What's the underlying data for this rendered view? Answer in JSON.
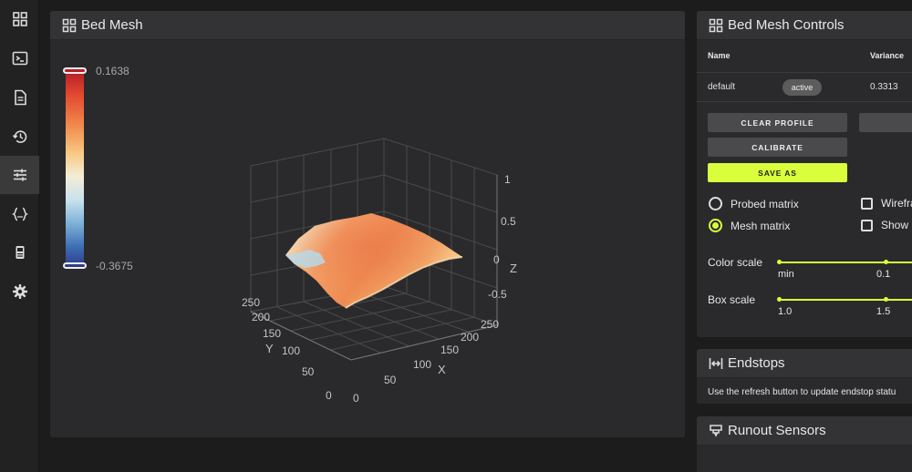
{
  "nav": {
    "items": [
      {
        "icon": "dashboard-icon"
      },
      {
        "icon": "console-icon"
      },
      {
        "icon": "document-icon"
      },
      {
        "icon": "history-icon"
      },
      {
        "icon": "tune-icon",
        "active": true
      },
      {
        "icon": "code-braces-icon"
      },
      {
        "icon": "printer-icon"
      },
      {
        "icon": "gear-icon"
      }
    ]
  },
  "mesh": {
    "title": "Bed Mesh",
    "scale_max": "0.1638",
    "scale_min": "-0.3675",
    "z_ticks": [
      "1",
      "0.5",
      "0",
      "-0.5"
    ],
    "z_label": "Z",
    "y_ticks": [
      "250",
      "200",
      "150",
      "100",
      "50",
      "0"
    ],
    "y_label": "Y",
    "x_ticks": [
      "0",
      "50",
      "100",
      "150",
      "200",
      "250"
    ],
    "x_label": "X"
  },
  "controls": {
    "title": "Bed Mesh Controls",
    "col_name": "Name",
    "col_variance": "Variance",
    "profile_name": "default",
    "profile_status": "active",
    "profile_variance": "0.3313",
    "clear_profile": "CLEAR PROFILE",
    "calibrate": "CALIBRATE",
    "save_as": "SAVE AS",
    "probed_matrix": "Probed matrix",
    "mesh_matrix": "Mesh matrix",
    "wireframe": "Wirefra",
    "show": "Show",
    "color_scale_label": "Color scale",
    "color_scale_values": [
      "min",
      "0.1"
    ],
    "box_scale_label": "Box scale",
    "box_scale_values": [
      "1.0",
      "1.5"
    ],
    "selected_matrix": "mesh"
  },
  "endstops": {
    "title": "Endstops",
    "body": "Use the refresh button to update endstop statu"
  },
  "runout": {
    "title": "Runout Sensors"
  },
  "colors": {
    "accent": "#d9ff3c",
    "background": "#1c1c1c",
    "card": "#2a2a2c"
  }
}
